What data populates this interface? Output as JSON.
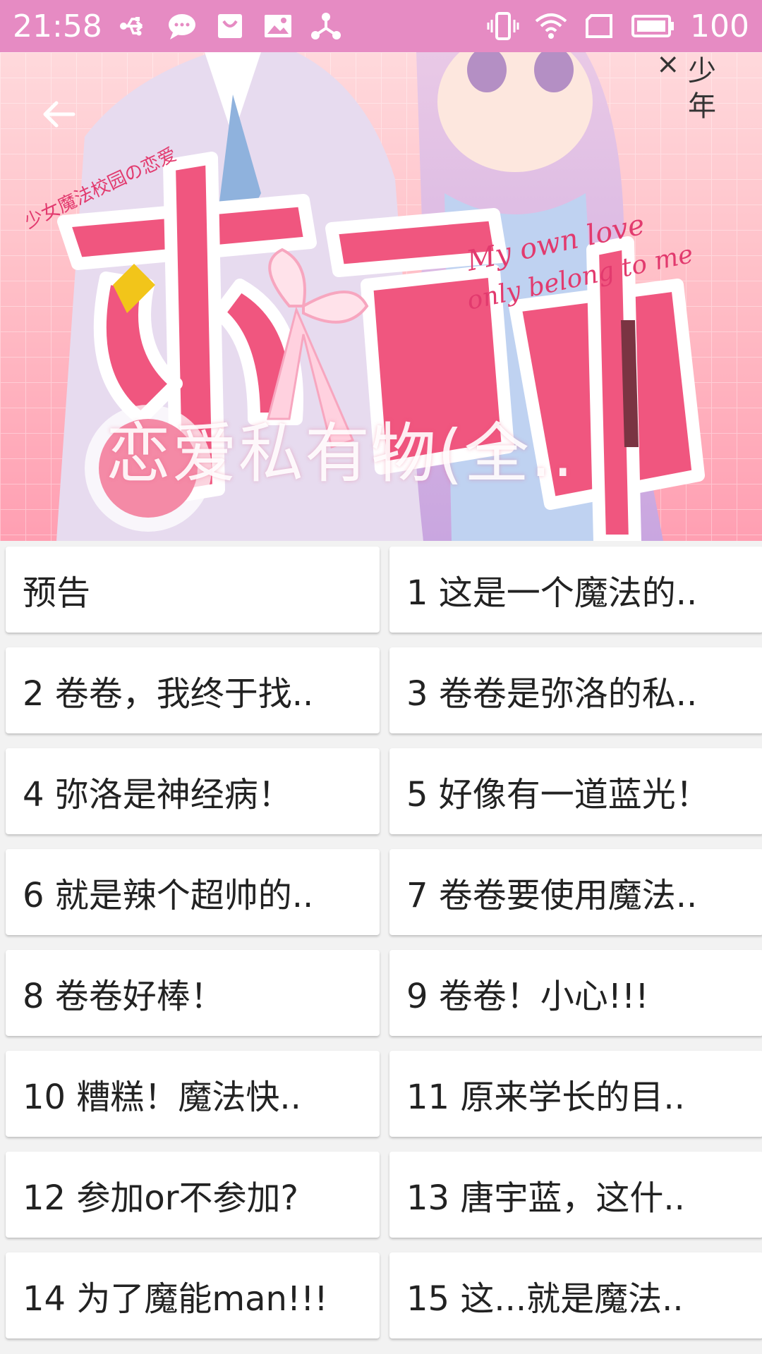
{
  "status_bar": {
    "time": "21:58",
    "battery": "100",
    "left_icons": [
      "usb-icon",
      "chat-bubble-icon",
      "shopping-bag-icon",
      "image-icon",
      "share-icon"
    ],
    "right_icons": [
      "vibrate-icon",
      "wifi-icon",
      "sim-icon",
      "battery-icon"
    ],
    "background": "#e68bc3"
  },
  "cover": {
    "title": "恋爱私有物(全.."
  },
  "chapters": [
    "预告",
    "1 这是一个魔法的..",
    "2 卷卷，我终于找..",
    "3 卷卷是弥洛的私..",
    "4 弥洛是神经病！",
    "5 好像有一道蓝光！",
    "6 就是辣个超帅的..",
    "7 卷卷要使用魔法..",
    "8 卷卷好棒！",
    "9 卷卷！小心!!!",
    "10 糟糕！魔法快..",
    "11 原来学长的目..",
    "12 参加or不参加?",
    "13 唐宇蓝，这什..",
    "14 为了魔能man!!!",
    "15 这...就是魔法.."
  ]
}
